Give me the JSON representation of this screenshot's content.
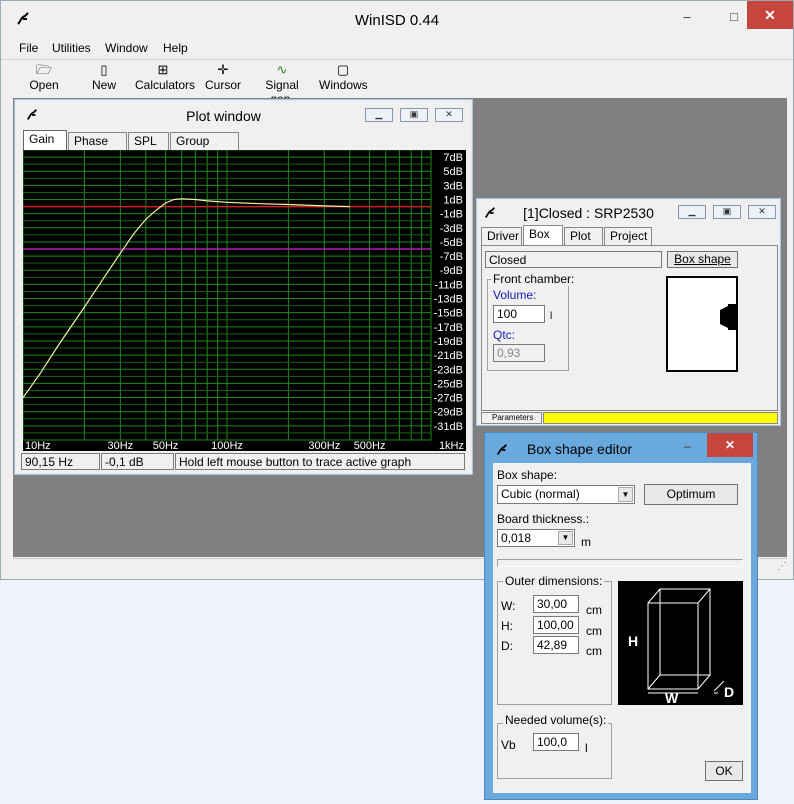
{
  "app": {
    "title": "WinISD 0.44"
  },
  "menu": [
    "File",
    "Utilities",
    "Window",
    "Help"
  ],
  "toolbar": {
    "open": "Open",
    "new": "New",
    "calculators": "Calculators",
    "cursor": "Cursor",
    "signal_gen": "Signal gen.",
    "windows": "Windows"
  },
  "plot_window": {
    "title": "Plot window",
    "tabs": [
      "Gain",
      "Phase plot",
      "SPL",
      "Group delay"
    ],
    "active_tab": "Gain",
    "status": {
      "frequency": "90,15 Hz",
      "gain": "-0,1 dB",
      "hint": "Hold left mouse button to trace active graph"
    }
  },
  "chart_data": {
    "type": "line",
    "title": "",
    "xlabel": "",
    "ylabel": "",
    "x_scale": "log",
    "xlim": [
      10,
      1000
    ],
    "ylim": [
      -33,
      8
    ],
    "grid": true,
    "y_tick_labels": [
      "7dB",
      "5dB",
      "3dB",
      "1dB",
      "-1dB",
      "-3dB",
      "-5dB",
      "-7dB",
      "-9dB",
      "-11dB",
      "-13dB",
      "-15dB",
      "-17dB",
      "-19dB",
      "-21dB",
      "-23dB",
      "-25dB",
      "-27dB",
      "-29dB",
      "-31dB"
    ],
    "x_tick_labels": [
      {
        "label": "10Hz",
        "value": 10
      },
      {
        "label": "30Hz",
        "value": 30
      },
      {
        "label": "50Hz",
        "value": 50
      },
      {
        "label": "100Hz",
        "value": 100
      },
      {
        "label": "300Hz",
        "value": 300
      },
      {
        "label": "500Hz",
        "value": 500
      },
      {
        "label": "1kHz",
        "value": 1000
      }
    ],
    "reference_lines": [
      {
        "value": 0,
        "color": "#cc2222"
      },
      {
        "value": -6,
        "color": "#aa22aa"
      }
    ],
    "series": [
      {
        "color": "#f0f0a0",
        "x": [
          10,
          12,
          15,
          20,
          25,
          30,
          35,
          40,
          45,
          50,
          55,
          60,
          70,
          80,
          90,
          100,
          150,
          200,
          300,
          400
        ],
        "y": [
          -27.0,
          -23.8,
          -19.5,
          -14.2,
          -10.0,
          -6.6,
          -3.8,
          -1.8,
          -0.5,
          0.5,
          1.0,
          1.1,
          1.0,
          0.8,
          0.7,
          0.6,
          0.4,
          0.3,
          0.1,
          0.0
        ]
      }
    ]
  },
  "closed_window": {
    "title": "[1]Closed : SRP2530",
    "tabs": [
      "Driver",
      "Box",
      "Plot",
      "Project"
    ],
    "active_tab": "Box",
    "box_type": "Closed",
    "box_shape_button": "Box shape",
    "front_chamber_label": "Front chamber:",
    "volume_label": "Volume:",
    "volume_value": "100",
    "volume_unit": "l",
    "qtc_label": "Qtc:",
    "qtc_value": "0,93",
    "status_label": "Parameters",
    "status_color": "#ffff00"
  },
  "box_editor": {
    "title": "Box shape editor",
    "box_shape_label": "Box shape:",
    "box_shape_value": "Cubic (normal)",
    "optimum_button": "Optimum",
    "board_thickness_label": "Board thickness.:",
    "board_thickness_value": "0,018",
    "board_thickness_unit": "m",
    "outer_dimensions_label": "Outer dimensions:",
    "w_label": "W:",
    "w_value": "30,00",
    "h_label": "H:",
    "h_value": "100,00",
    "d_label": "D:",
    "d_value": "42,89",
    "dim_unit": "cm",
    "needed_volume_label": "Needed volume(s):",
    "vb_label": "Vb",
    "vb_value": "100,0",
    "vb_unit": "l",
    "ok_button": "OK",
    "diagram_labels": {
      "h": "H",
      "w": "W",
      "d": "D"
    }
  }
}
